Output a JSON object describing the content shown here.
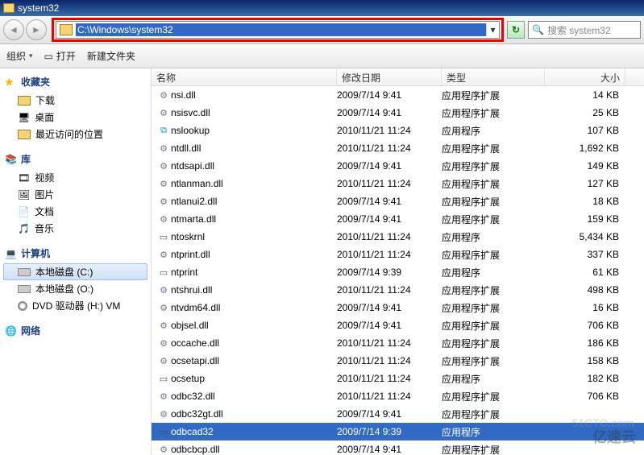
{
  "window": {
    "title": "system32"
  },
  "nav": {
    "address": "C:\\Windows\\system32",
    "search_placeholder": "搜索 system32"
  },
  "toolbar": {
    "organize": "组织",
    "open": "打开",
    "newfolder": "新建文件夹"
  },
  "sidebar": {
    "favorites": {
      "title": "收藏夹",
      "items": [
        "下载",
        "桌面",
        "最近访问的位置"
      ]
    },
    "libraries": {
      "title": "库",
      "items": [
        "视频",
        "图片",
        "文档",
        "音乐"
      ]
    },
    "computer": {
      "title": "计算机",
      "items": [
        "本地磁盘 (C:)",
        "本地磁盘 (O:)",
        "DVD 驱动器 (H:) VM"
      ]
    },
    "network": {
      "title": "网络"
    }
  },
  "columns": {
    "name": "名称",
    "date": "修改日期",
    "type": "类型",
    "size": "大小"
  },
  "files": [
    {
      "icon": "gear",
      "name": "nsi.dll",
      "date": "2009/7/14 9:41",
      "type": "应用程序扩展",
      "size": "14 KB"
    },
    {
      "icon": "gear",
      "name": "nsisvc.dll",
      "date": "2009/7/14 9:41",
      "type": "应用程序扩展",
      "size": "25 KB"
    },
    {
      "icon": "exe",
      "name": "nslookup",
      "date": "2010/11/21 11:24",
      "type": "应用程序",
      "size": "107 KB"
    },
    {
      "icon": "gear",
      "name": "ntdll.dll",
      "date": "2010/11/21 11:24",
      "type": "应用程序扩展",
      "size": "1,692 KB"
    },
    {
      "icon": "gear",
      "name": "ntdsapi.dll",
      "date": "2009/7/14 9:41",
      "type": "应用程序扩展",
      "size": "149 KB"
    },
    {
      "icon": "gear",
      "name": "ntlanman.dll",
      "date": "2010/11/21 11:24",
      "type": "应用程序扩展",
      "size": "127 KB"
    },
    {
      "icon": "gear",
      "name": "ntlanui2.dll",
      "date": "2009/7/14 9:41",
      "type": "应用程序扩展",
      "size": "18 KB"
    },
    {
      "icon": "gear",
      "name": "ntmarta.dll",
      "date": "2009/7/14 9:41",
      "type": "应用程序扩展",
      "size": "159 KB"
    },
    {
      "icon": "app",
      "name": "ntoskrnl",
      "date": "2010/11/21 11:24",
      "type": "应用程序",
      "size": "5,434 KB"
    },
    {
      "icon": "gear",
      "name": "ntprint.dll",
      "date": "2010/11/21 11:24",
      "type": "应用程序扩展",
      "size": "337 KB"
    },
    {
      "icon": "app",
      "name": "ntprint",
      "date": "2009/7/14 9:39",
      "type": "应用程序",
      "size": "61 KB"
    },
    {
      "icon": "gear",
      "name": "ntshrui.dll",
      "date": "2010/11/21 11:24",
      "type": "应用程序扩展",
      "size": "498 KB"
    },
    {
      "icon": "gear",
      "name": "ntvdm64.dll",
      "date": "2009/7/14 9:41",
      "type": "应用程序扩展",
      "size": "16 KB"
    },
    {
      "icon": "gear",
      "name": "objsel.dll",
      "date": "2009/7/14 9:41",
      "type": "应用程序扩展",
      "size": "706 KB"
    },
    {
      "icon": "gear",
      "name": "occache.dll",
      "date": "2010/11/21 11:24",
      "type": "应用程序扩展",
      "size": "186 KB"
    },
    {
      "icon": "gear",
      "name": "ocsetapi.dll",
      "date": "2010/11/21 11:24",
      "type": "应用程序扩展",
      "size": "158 KB"
    },
    {
      "icon": "app",
      "name": "ocsetup",
      "date": "2010/11/21 11:24",
      "type": "应用程序",
      "size": "182 KB"
    },
    {
      "icon": "gear",
      "name": "odbc32.dll",
      "date": "2010/11/21 11:24",
      "type": "应用程序扩展",
      "size": "706 KB"
    },
    {
      "icon": "gear",
      "name": "odbc32gt.dll",
      "date": "2009/7/14 9:41",
      "type": "应用程序扩展",
      "size": ""
    },
    {
      "icon": "app",
      "name": "odbcad32",
      "date": "2009/7/14 9:39",
      "type": "应用程序",
      "size": "",
      "selected": true
    },
    {
      "icon": "gear",
      "name": "odbcbcp.dll",
      "date": "2009/7/14 9:41",
      "type": "应用程序扩展",
      "size": ""
    }
  ],
  "watermark": {
    "line1": "51CTO.com",
    "line2": "亿速云"
  }
}
